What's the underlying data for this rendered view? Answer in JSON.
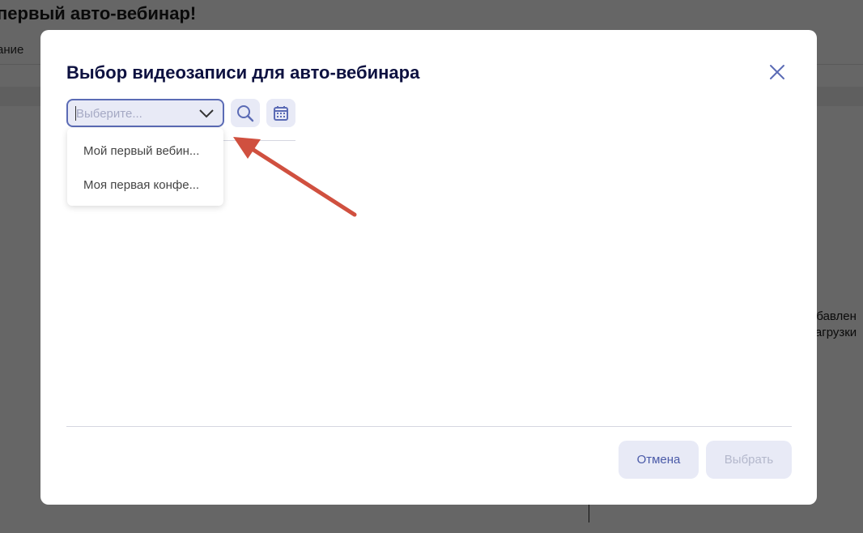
{
  "background": {
    "page_title": "первый авто-вебинар!",
    "tab_fragment": "ание",
    "right_text_line1": "обавлен",
    "right_text_line2": "загрузки"
  },
  "modal": {
    "title": "Выбор видеозаписи для авто-вебинара",
    "select": {
      "placeholder": "Выберите...",
      "options": [
        "Мой первый вебин...",
        "Моя первая конфе..."
      ]
    },
    "cancel_label": "Отмена",
    "choose_label": "Выбрать"
  },
  "colors": {
    "accent": "#5b6bb5",
    "button_bg": "#e8eaf6",
    "arrow": "#d0503f"
  }
}
